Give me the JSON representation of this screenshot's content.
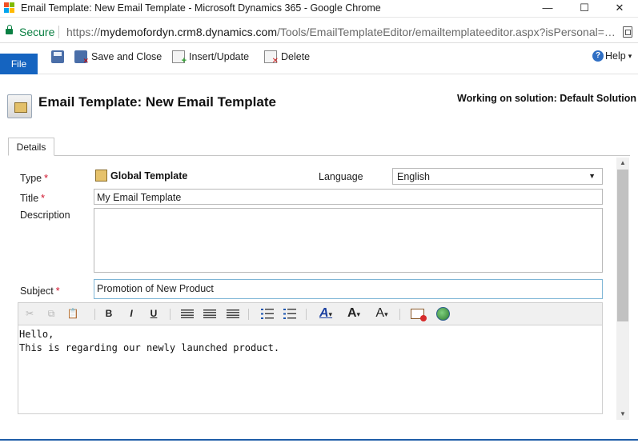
{
  "window": {
    "title": "Email Template: New Email Template - Microsoft Dynamics 365 - Google Chrome",
    "minimize": "—",
    "maximize": "☐",
    "close": "✕"
  },
  "address": {
    "secure_label": "Secure",
    "url_scheme": "https://",
    "url_host": "mydemofordyn.crm8.dynamics.com",
    "url_path": "/Tools/EmailTemplateEditor/emailtemplateeditor.aspx?isPersonal=…"
  },
  "ribbon": {
    "file_label": "File",
    "save_close_label": "Save and Close",
    "insert_update_label": "Insert/Update",
    "delete_label": "Delete",
    "help_label": "Help",
    "help_arrow": "▾"
  },
  "header": {
    "title": "Email Template: New Email Template",
    "solution": "Working on solution: Default Solution"
  },
  "tabs": [
    {
      "label": "Details"
    }
  ],
  "form": {
    "type_label": "Type",
    "type_value": "Global Template",
    "language_label": "Language",
    "language_value": "English",
    "title_label": "Title",
    "title_value": "My Email Template",
    "description_label": "Description",
    "description_value": "",
    "subject_label": "Subject",
    "subject_value": "Promotion of New Product",
    "required_marker": "*"
  },
  "editor": {
    "toolbar": {
      "cut": "✂",
      "copy": "⧉",
      "paste": "📋",
      "bold": "B",
      "italic": "I",
      "underline": "U",
      "font_color": "A",
      "font_size": "A",
      "font_face": "A",
      "dropdown": "▾"
    },
    "body_lines": [
      "Hello,",
      "This is regarding our newly launched product."
    ]
  },
  "scrollbar": {
    "up": "▲",
    "down": "▼"
  }
}
